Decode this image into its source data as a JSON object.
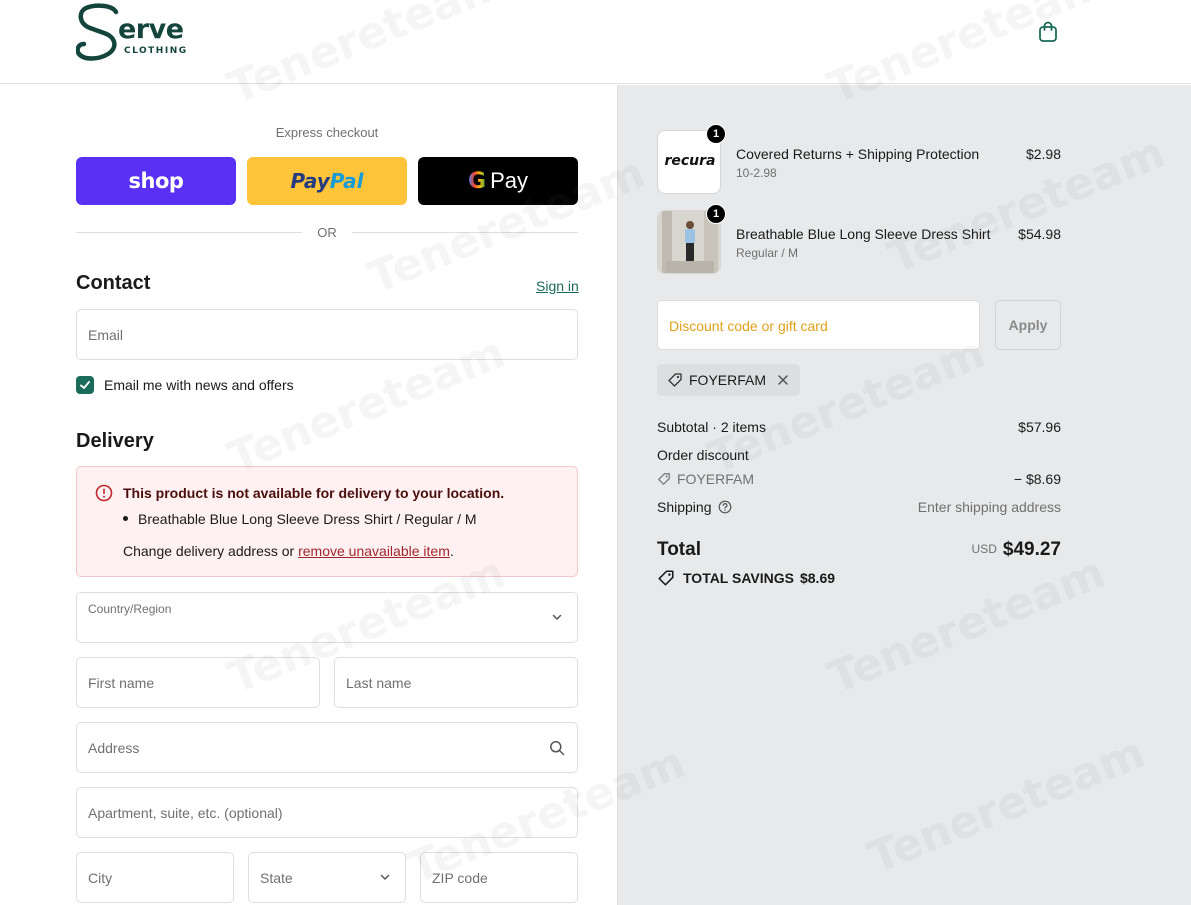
{
  "header": {
    "logo_word": "erve",
    "logo_sub": "CLOTHING",
    "cart_icon": "shopping-bag-icon"
  },
  "express": {
    "title": "Express checkout",
    "shop_label": "shop",
    "paypal_part1": "Pay",
    "paypal_part2": "Pal",
    "gpay_g": "G",
    "gpay_label": "Pay",
    "or_label": "OR"
  },
  "contact": {
    "title": "Contact",
    "signin": "Sign in",
    "email_placeholder": "Email",
    "news_label": "Email me with news and offers",
    "news_checked": true
  },
  "delivery": {
    "title": "Delivery",
    "alert_title": "This product is not available for delivery to your location.",
    "alert_item": "Breathable Blue Long Sleeve Dress Shirt / Regular / M",
    "alert_action_prefix": "Change delivery address or ",
    "alert_action_link": "remove unavailable item",
    "alert_action_suffix": ".",
    "country_label": "Country/Region",
    "country_value": "",
    "first_name": "First name",
    "last_name": "Last name",
    "address": "Address",
    "apartment": "Apartment, suite, etc. (optional)",
    "city": "City",
    "state": "State",
    "zip": "ZIP code"
  },
  "cart": {
    "items": [
      {
        "qty": "1",
        "name": "Covered Returns + Shipping Protection",
        "variant": "10-2.98",
        "price": "$2.98",
        "thumb_text": "recura"
      },
      {
        "qty": "1",
        "name": "Breathable Blue Long Sleeve Dress Shirt",
        "variant": "Regular / M",
        "price": "$54.98"
      }
    ],
    "discount_placeholder": "Discount code or gift card",
    "apply_label": "Apply",
    "applied_code": "FOYERFAM"
  },
  "summary": {
    "subtotal_label": "Subtotal · 2 items",
    "subtotal_value": "$57.96",
    "discount_label": "Order discount",
    "discount_code": "FOYERFAM",
    "discount_value": "− $8.69",
    "shipping_label": "Shipping",
    "shipping_value": "Enter shipping address",
    "total_label": "Total",
    "currency": "USD",
    "total_value": "$49.27",
    "savings_label": "TOTAL SAVINGS",
    "savings_value": "$8.69"
  },
  "colors": {
    "brand": "#14453d",
    "accent": "#1b6b5a",
    "shop_pay": "#5a31f4",
    "paypal": "#ffc439",
    "error": "#a0262e"
  },
  "watermark": "Tenereteam"
}
